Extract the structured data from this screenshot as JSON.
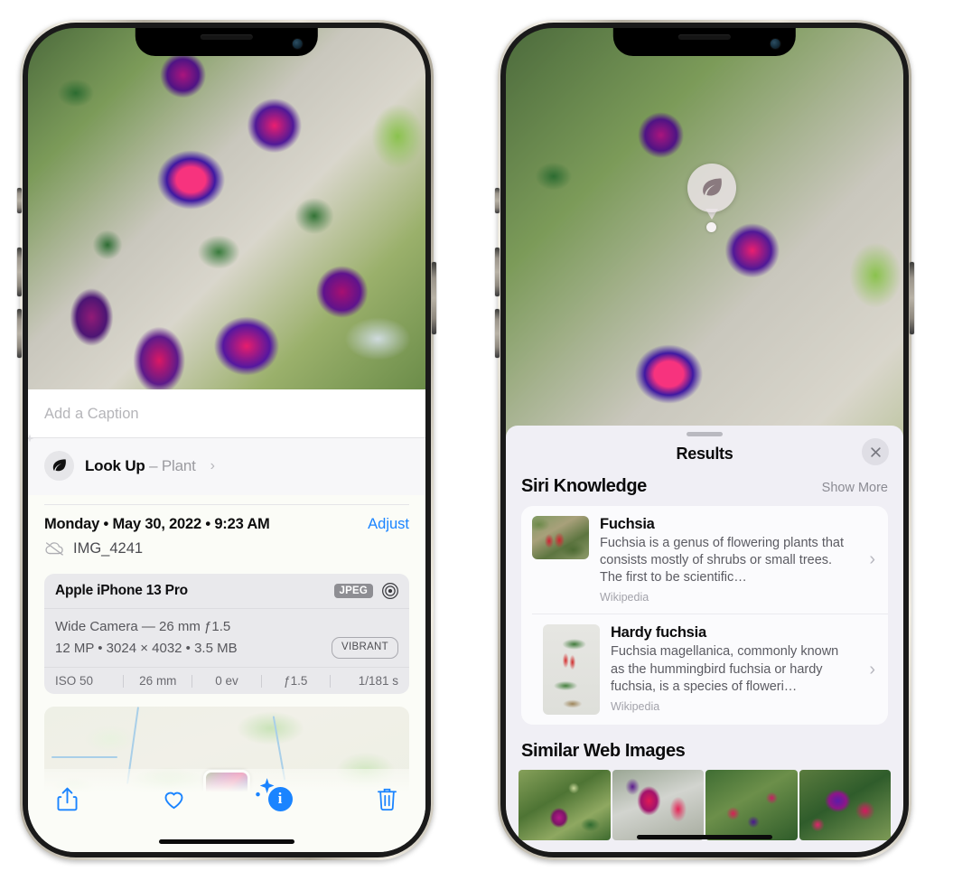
{
  "left_phone": {
    "name": "photos-info-screen",
    "caption_placeholder": "Add a Caption",
    "caption_value": "",
    "lookup": {
      "label": "Look Up",
      "separator": "–",
      "subject": "Plant",
      "chevron": "›",
      "icon": "leaf-icon"
    },
    "meta": {
      "date": "Monday • May 30, 2022 • 9:23 AM",
      "adjust_label": "Adjust",
      "filename": "IMG_4241",
      "cloud_icon": "cloud-slash-icon"
    },
    "camera_card": {
      "model": "Apple iPhone 13 Pro",
      "format_chip": "JPEG",
      "aperture_icon": "aperture-icon",
      "lens_line": "Wide Camera — 26 mm ƒ1.5",
      "specs_line": "12 MP • 3024 × 4032 • 3.5 MB",
      "style_chip": "VIBRANT",
      "exif": [
        "ISO 50",
        "26 mm",
        "0 ev",
        "ƒ1.5",
        "1/181 s"
      ]
    },
    "toolbar": {
      "share_label": "share-icon",
      "favorite_label": "heart-icon",
      "info_label": "info-icon",
      "delete_label": "trash-icon",
      "accent_color": "#1a84ff"
    }
  },
  "right_phone": {
    "name": "visual-look-up-results-screen",
    "photo_badge": {
      "icon": "leaf-icon",
      "tooltip": "Visual Look Up plant indicator"
    },
    "sheet": {
      "title": "Results",
      "close_label": "×",
      "sections": [
        {
          "title": "Siri Knowledge",
          "action_label": "Show More",
          "items": [
            {
              "title": "Fuchsia",
              "description": "Fuchsia is a genus of flowering plants that consists mostly of shrubs or small trees. The first to be scientific…",
              "source": "Wikipedia",
              "chevron": "›"
            },
            {
              "title": "Hardy fuchsia",
              "description": "Fuchsia magellanica, commonly known as the hummingbird fuchsia or hardy fuchsia, is a species of floweri…",
              "source": "Wikipedia",
              "chevron": "›"
            }
          ]
        },
        {
          "title": "Similar Web Images",
          "items": [
            {
              "alt": "fuchsia-web-image-1"
            },
            {
              "alt": "fuchsia-web-image-2"
            },
            {
              "alt": "fuchsia-web-image-3"
            },
            {
              "alt": "fuchsia-web-image-4"
            }
          ]
        }
      ]
    }
  },
  "colors": {
    "accent_blue": "#1a84ff",
    "sheet_bg": "#f0eff5",
    "card_bg": "#fbfbfd",
    "info_bg": "#fbfcf7",
    "chip_gray": "#8e8e93"
  }
}
